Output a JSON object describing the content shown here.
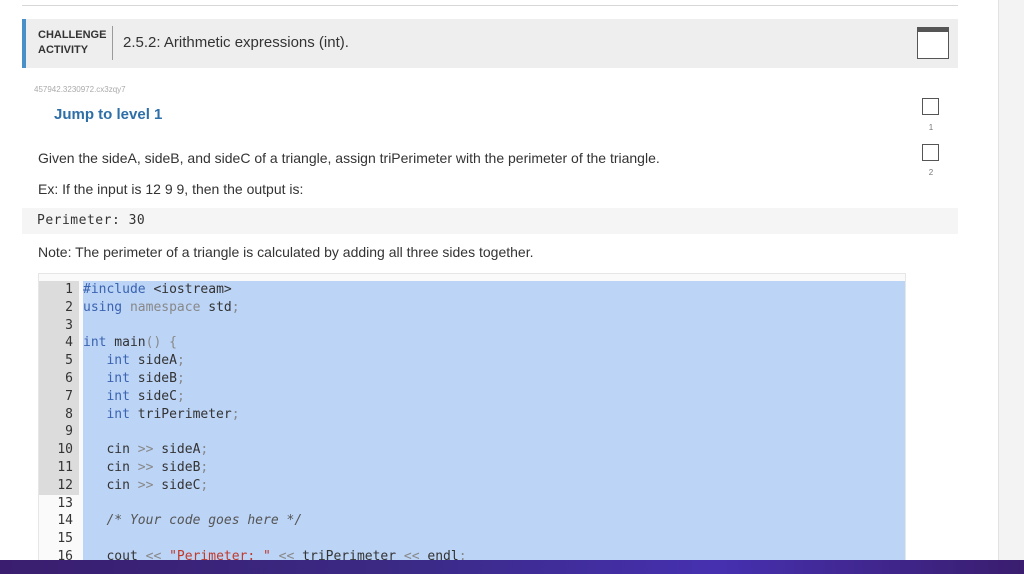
{
  "header": {
    "challenge_line1": "CHALLENGE",
    "challenge_line2": "ACTIVITY",
    "title": "2.5.2: Arithmetic expressions (int)."
  },
  "activity_id": "457942.3230972.cx3zqy7",
  "jump_link": "Jump to level 1",
  "levels": [
    {
      "label": "1"
    },
    {
      "label": "2"
    }
  ],
  "prompt": {
    "instruction": "Given the sideA, sideB, and sideC of a triangle, assign triPerimeter with the perimeter of the triangle.",
    "example": "Ex: If the input is 12 9 9, then the output is:",
    "output_sample": "Perimeter: 30",
    "note": "Note: The perimeter of a triangle is calculated by adding all three sides together."
  },
  "editor": {
    "line_numbers": [
      "1",
      "2",
      "3",
      "4",
      "5",
      "6",
      "7",
      "8",
      "9",
      "10",
      "11",
      "12",
      "13",
      "14",
      "15",
      "16"
    ],
    "selected_lines": 12,
    "code": {
      "l1_kw": "#include",
      "l1_rest": " <iostream>",
      "l2_kw": "using",
      "l2_ns": " namespace",
      "l2_rest": " std",
      "l2_semi": ";",
      "l4_kw": "int",
      "l4_rest": " main",
      "l4_punct": "() {",
      "l5_indent": "   ",
      "l5_kw": "int",
      "l5_rest": " sideA",
      "l6_rest": " sideB",
      "l7_rest": " sideC",
      "l8_rest": " triPerimeter",
      "semi": ";",
      "l10_a": "   cin ",
      "l10_op": ">>",
      "l10_b": " sideA",
      "l11_b": " sideB",
      "l12_b": " sideC",
      "l14_comment": "   /* Your code goes here */",
      "l16_a": "   cout ",
      "l16_op1": "<<",
      "l16_str": " \"Perimeter: \"",
      "l16_op2": " <<",
      "l16_b": " triPerimeter",
      "l16_op3": " <<",
      "l16_c": " endl",
      "l16_semi": ";"
    }
  },
  "colors": {
    "accent": "#4a90c8",
    "link": "#2e6fa8",
    "selection": "#bcd4f6",
    "keyword": "#3a63b0"
  }
}
